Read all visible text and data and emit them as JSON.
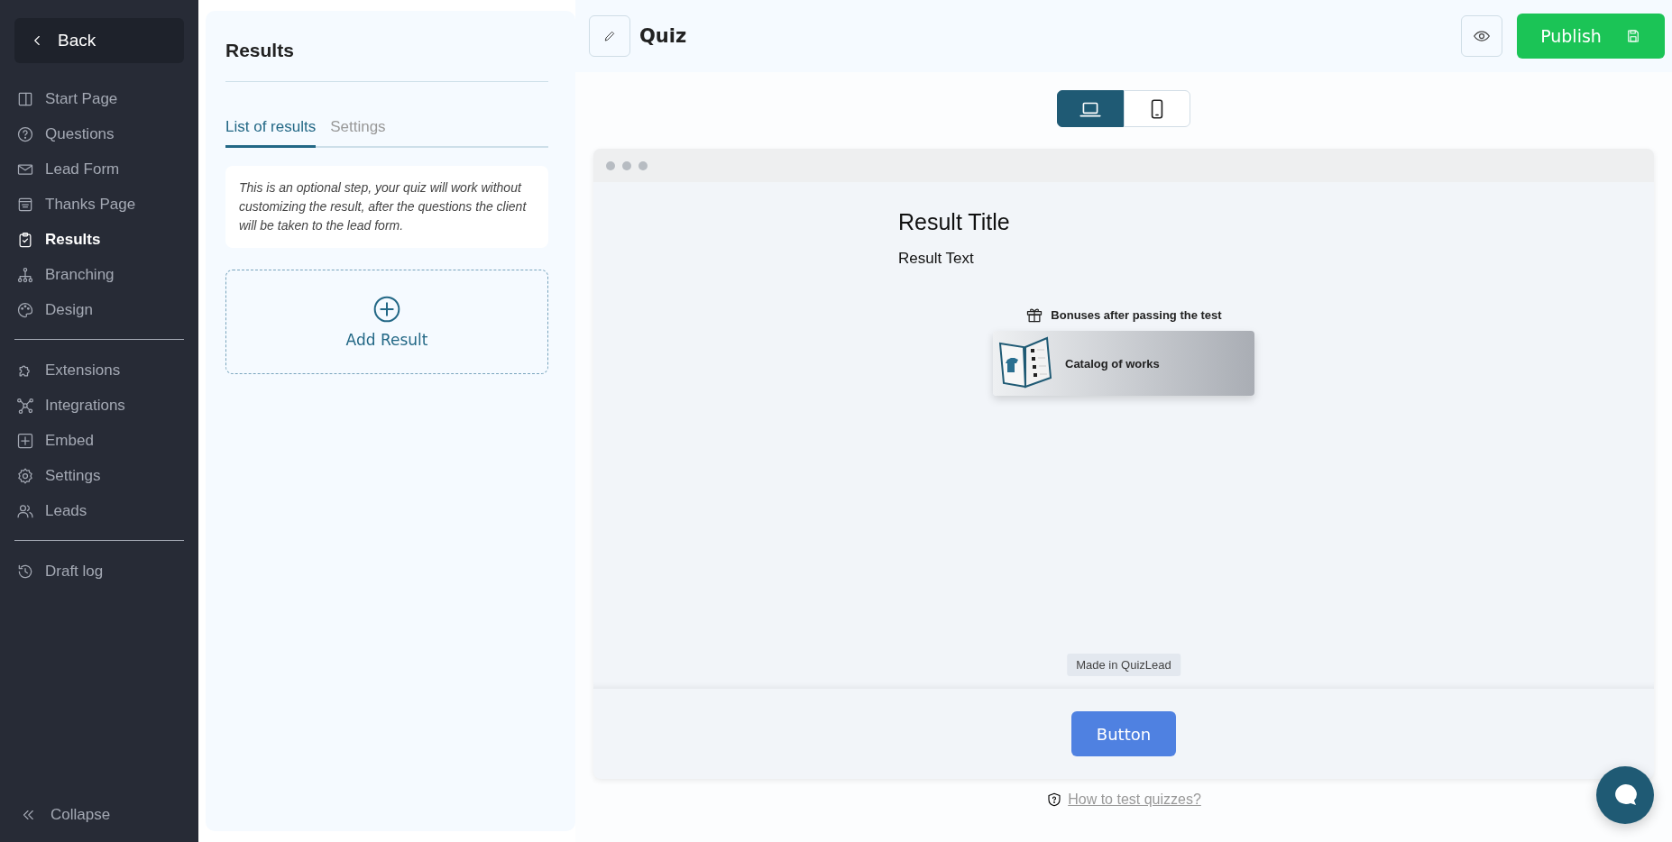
{
  "sidebar": {
    "back": "Back",
    "groups": [
      [
        {
          "label": "Start Page",
          "selected": false
        },
        {
          "label": "Questions",
          "selected": false
        },
        {
          "label": "Lead Form",
          "selected": false
        },
        {
          "label": "Thanks Page",
          "selected": false
        },
        {
          "label": "Results",
          "selected": true
        },
        {
          "label": "Branching",
          "selected": false
        },
        {
          "label": "Design",
          "selected": false
        }
      ],
      [
        {
          "label": "Extensions",
          "selected": false
        },
        {
          "label": "Integrations",
          "selected": false
        },
        {
          "label": "Embed",
          "selected": false
        },
        {
          "label": "Settings",
          "selected": false
        },
        {
          "label": "Leads",
          "selected": false
        }
      ],
      [
        {
          "label": "Draft log",
          "selected": false
        }
      ]
    ],
    "collapse": "Collapse"
  },
  "panel": {
    "title": "Results",
    "tabs": [
      {
        "label": "List of results",
        "selected": true
      },
      {
        "label": "Settings",
        "selected": false
      }
    ],
    "note": "This is an optional step, your quiz will work without customizing the result, after the questions the client will be taken to the lead form.",
    "add_result": "Add Result"
  },
  "header": {
    "title": "Quiz",
    "publish": "Publish"
  },
  "devices": [
    {
      "kind": "desktop",
      "selected": true
    },
    {
      "kind": "mobile",
      "selected": false
    }
  ],
  "preview": {
    "result_title": "Result Title",
    "result_text": "Result Text",
    "bonuses_heading": "Bonuses after passing the test",
    "bonuses": [
      {
        "title": "Catalog of works"
      }
    ],
    "badge": "Made in QuizLead",
    "button": "Button"
  },
  "help_link": "How to test quizzes?"
}
